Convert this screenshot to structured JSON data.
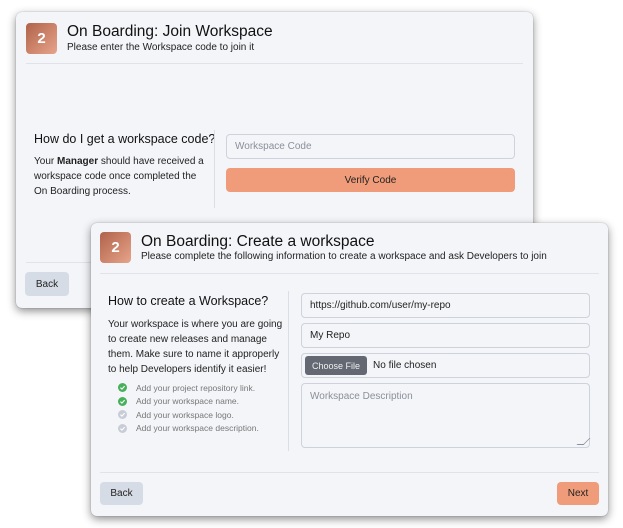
{
  "join_card": {
    "step_number": "2",
    "title": "On Boarding: Join Workspace",
    "subtitle": "Please enter the Workspace code to join it",
    "help_title": "How do I get a workspace code?",
    "help_prefix": "Your ",
    "help_bold": "Manager",
    "help_suffix": " should have received a workspace code once completed the On Boarding process.",
    "code_placeholder": "Workspace Code",
    "code_value": "",
    "verify_label": "Verify Code",
    "back_label": "Back"
  },
  "create_card": {
    "step_number": "2",
    "title": "On Boarding: Create a workspace",
    "subtitle": "Please complete the following information to create a workspace and ask Developers to join",
    "help_title": "How to create a Workspace?",
    "help_text": "Your workspace is where you are going to create new releases and manage them. Make sure to name it approperly to help Developers identify it easier!",
    "checklist": [
      {
        "label": "Add your project repository link.",
        "done": true
      },
      {
        "label": "Add your workspace name.",
        "done": true
      },
      {
        "label": "Add your workspace logo.",
        "done": false
      },
      {
        "label": "Add your workspace description.",
        "done": false
      }
    ],
    "repo_value": "https://github.com/user/my-repo",
    "name_value": "My Repo",
    "file_button_label": "Choose File",
    "file_status": "No file chosen",
    "description_placeholder": "Workspace Description",
    "back_label": "Back",
    "next_label": "Next"
  },
  "colors": {
    "accent": "#f09c7a",
    "check_done": "#47b05a",
    "check_todo": "#c8ccd6",
    "back_button": "#d6dce6"
  }
}
